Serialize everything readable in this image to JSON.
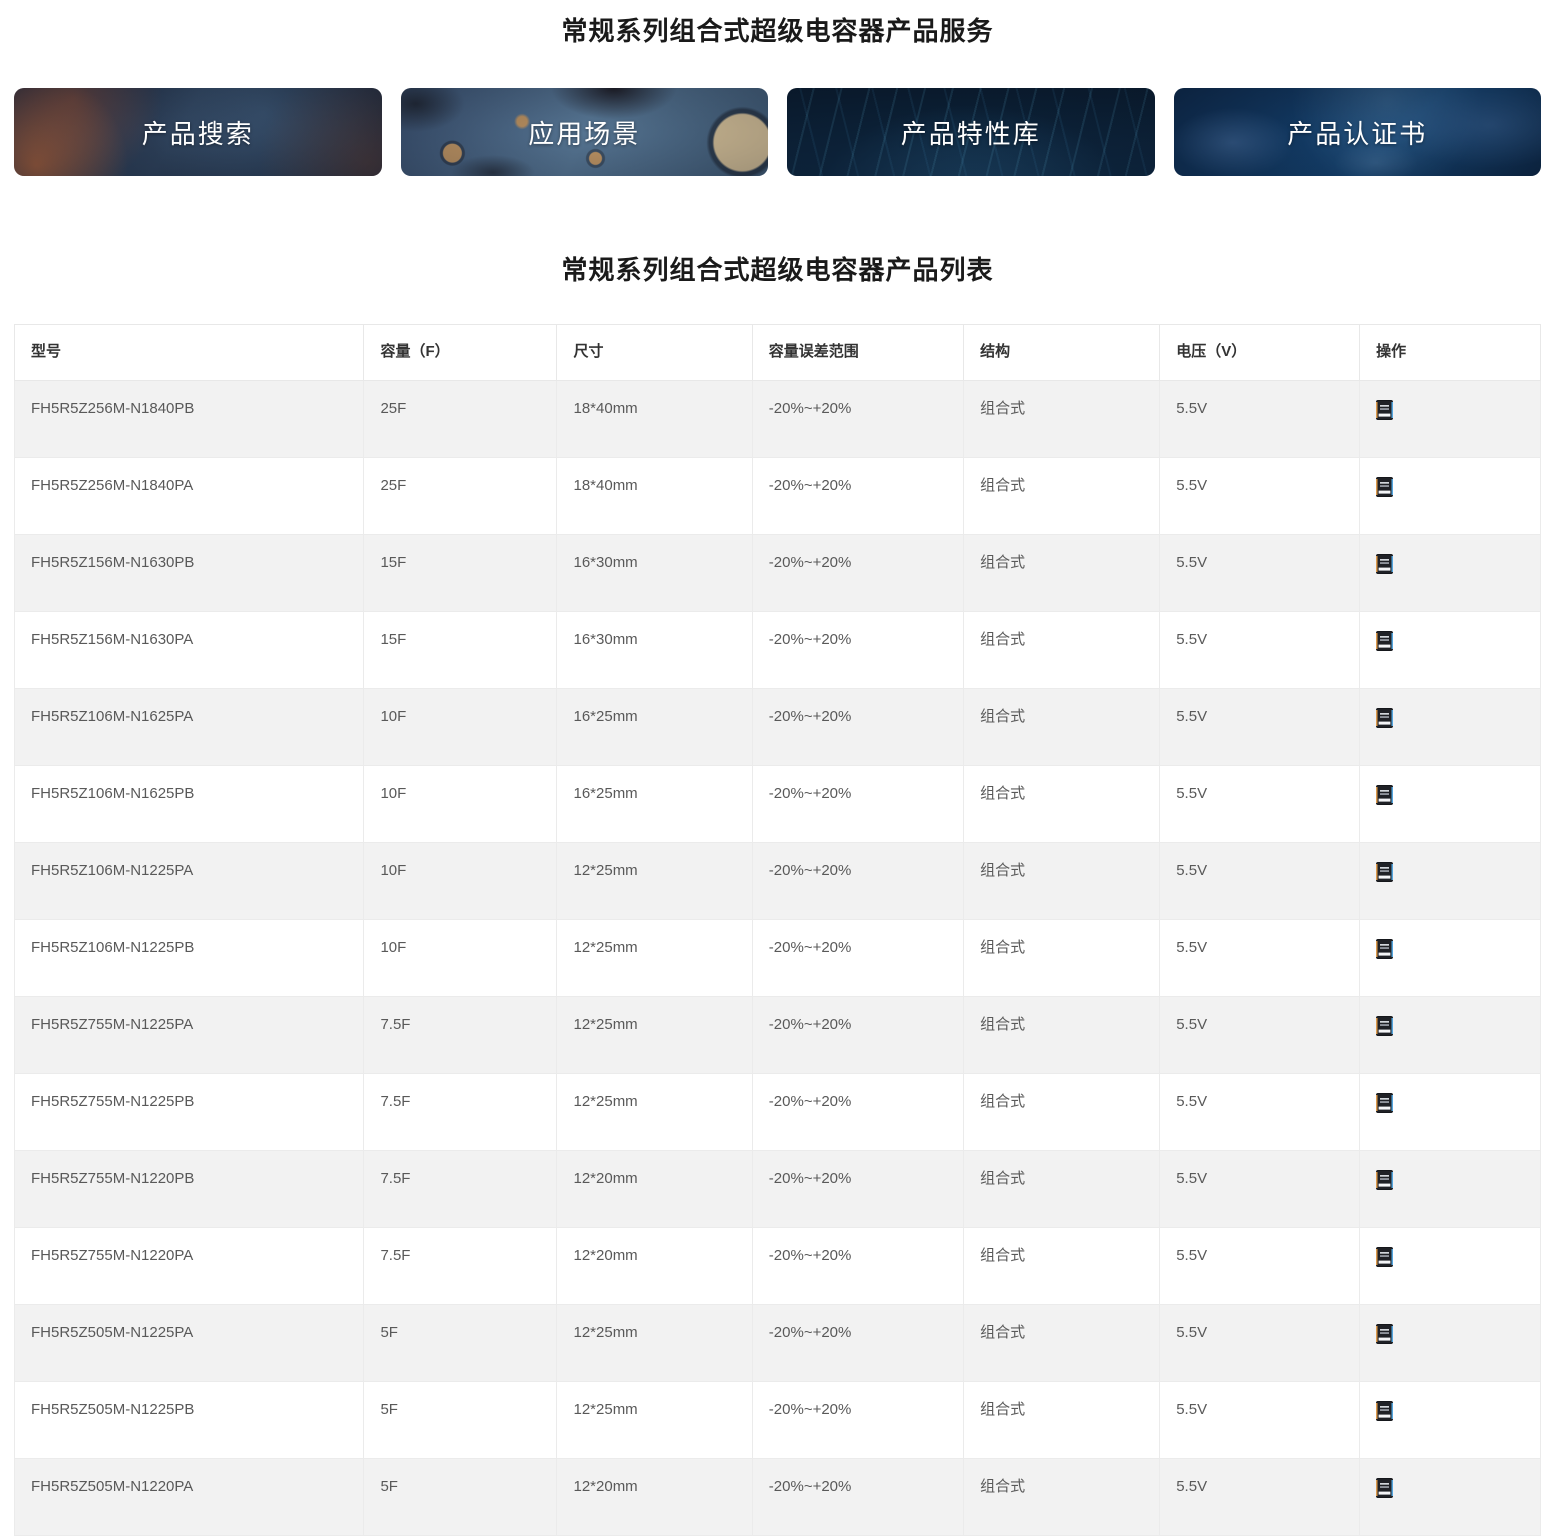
{
  "page": {
    "services_title": "常规系列组合式超级电容器产品服务",
    "list_title": "常规系列组合式超级电容器产品列表"
  },
  "banners": [
    {
      "label": "产品搜索"
    },
    {
      "label": "应用场景"
    },
    {
      "label": "产品特性库"
    },
    {
      "label": "产品认证书"
    }
  ],
  "table": {
    "headers": [
      "型号",
      "容量（F）",
      "尺寸",
      "容量误差范围",
      "结构",
      "电压（V）",
      "操作"
    ],
    "action_icon": "spec-document-icon",
    "rows": [
      {
        "model": "FH5R5Z256M-N1840PB",
        "capacity": "25F",
        "size": "18*40mm",
        "tolerance": "-20%~+20%",
        "structure": "组合式",
        "voltage": "5.5V"
      },
      {
        "model": "FH5R5Z256M-N1840PA",
        "capacity": "25F",
        "size": "18*40mm",
        "tolerance": "-20%~+20%",
        "structure": "组合式",
        "voltage": "5.5V"
      },
      {
        "model": "FH5R5Z156M-N1630PB",
        "capacity": "15F",
        "size": "16*30mm",
        "tolerance": "-20%~+20%",
        "structure": "组合式",
        "voltage": "5.5V"
      },
      {
        "model": "FH5R5Z156M-N1630PA",
        "capacity": "15F",
        "size": "16*30mm",
        "tolerance": "-20%~+20%",
        "structure": "组合式",
        "voltage": "5.5V"
      },
      {
        "model": "FH5R5Z106M-N1625PA",
        "capacity": "10F",
        "size": "16*25mm",
        "tolerance": "-20%~+20%",
        "structure": "组合式",
        "voltage": "5.5V"
      },
      {
        "model": "FH5R5Z106M-N1625PB",
        "capacity": "10F",
        "size": "16*25mm",
        "tolerance": "-20%~+20%",
        "structure": "组合式",
        "voltage": "5.5V"
      },
      {
        "model": "FH5R5Z106M-N1225PA",
        "capacity": "10F",
        "size": "12*25mm",
        "tolerance": "-20%~+20%",
        "structure": "组合式",
        "voltage": "5.5V"
      },
      {
        "model": "FH5R5Z106M-N1225PB",
        "capacity": "10F",
        "size": "12*25mm",
        "tolerance": "-20%~+20%",
        "structure": "组合式",
        "voltage": "5.5V"
      },
      {
        "model": "FH5R5Z755M-N1225PA",
        "capacity": "7.5F",
        "size": "12*25mm",
        "tolerance": "-20%~+20%",
        "structure": "组合式",
        "voltage": "5.5V"
      },
      {
        "model": "FH5R5Z755M-N1225PB",
        "capacity": "7.5F",
        "size": "12*25mm",
        "tolerance": "-20%~+20%",
        "structure": "组合式",
        "voltage": "5.5V"
      },
      {
        "model": "FH5R5Z755M-N1220PB",
        "capacity": "7.5F",
        "size": "12*20mm",
        "tolerance": "-20%~+20%",
        "structure": "组合式",
        "voltage": "5.5V"
      },
      {
        "model": "FH5R5Z755M-N1220PA",
        "capacity": "7.5F",
        "size": "12*20mm",
        "tolerance": "-20%~+20%",
        "structure": "组合式",
        "voltage": "5.5V"
      },
      {
        "model": "FH5R5Z505M-N1225PA",
        "capacity": "5F",
        "size": "12*25mm",
        "tolerance": "-20%~+20%",
        "structure": "组合式",
        "voltage": "5.5V"
      },
      {
        "model": "FH5R5Z505M-N1225PB",
        "capacity": "5F",
        "size": "12*25mm",
        "tolerance": "-20%~+20%",
        "structure": "组合式",
        "voltage": "5.5V"
      },
      {
        "model": "FH5R5Z505M-N1220PA",
        "capacity": "5F",
        "size": "12*20mm",
        "tolerance": "-20%~+20%",
        "structure": "组合式",
        "voltage": "5.5V"
      }
    ]
  },
  "colors": {
    "stripe_row": "#f2f2f2",
    "table_border": "#ebebeb",
    "header_text": "#333333",
    "cell_text": "#595959",
    "title_text": "#1a1a1a",
    "banner_label": "#ffffff",
    "banner_navy": "#0e2a45"
  }
}
